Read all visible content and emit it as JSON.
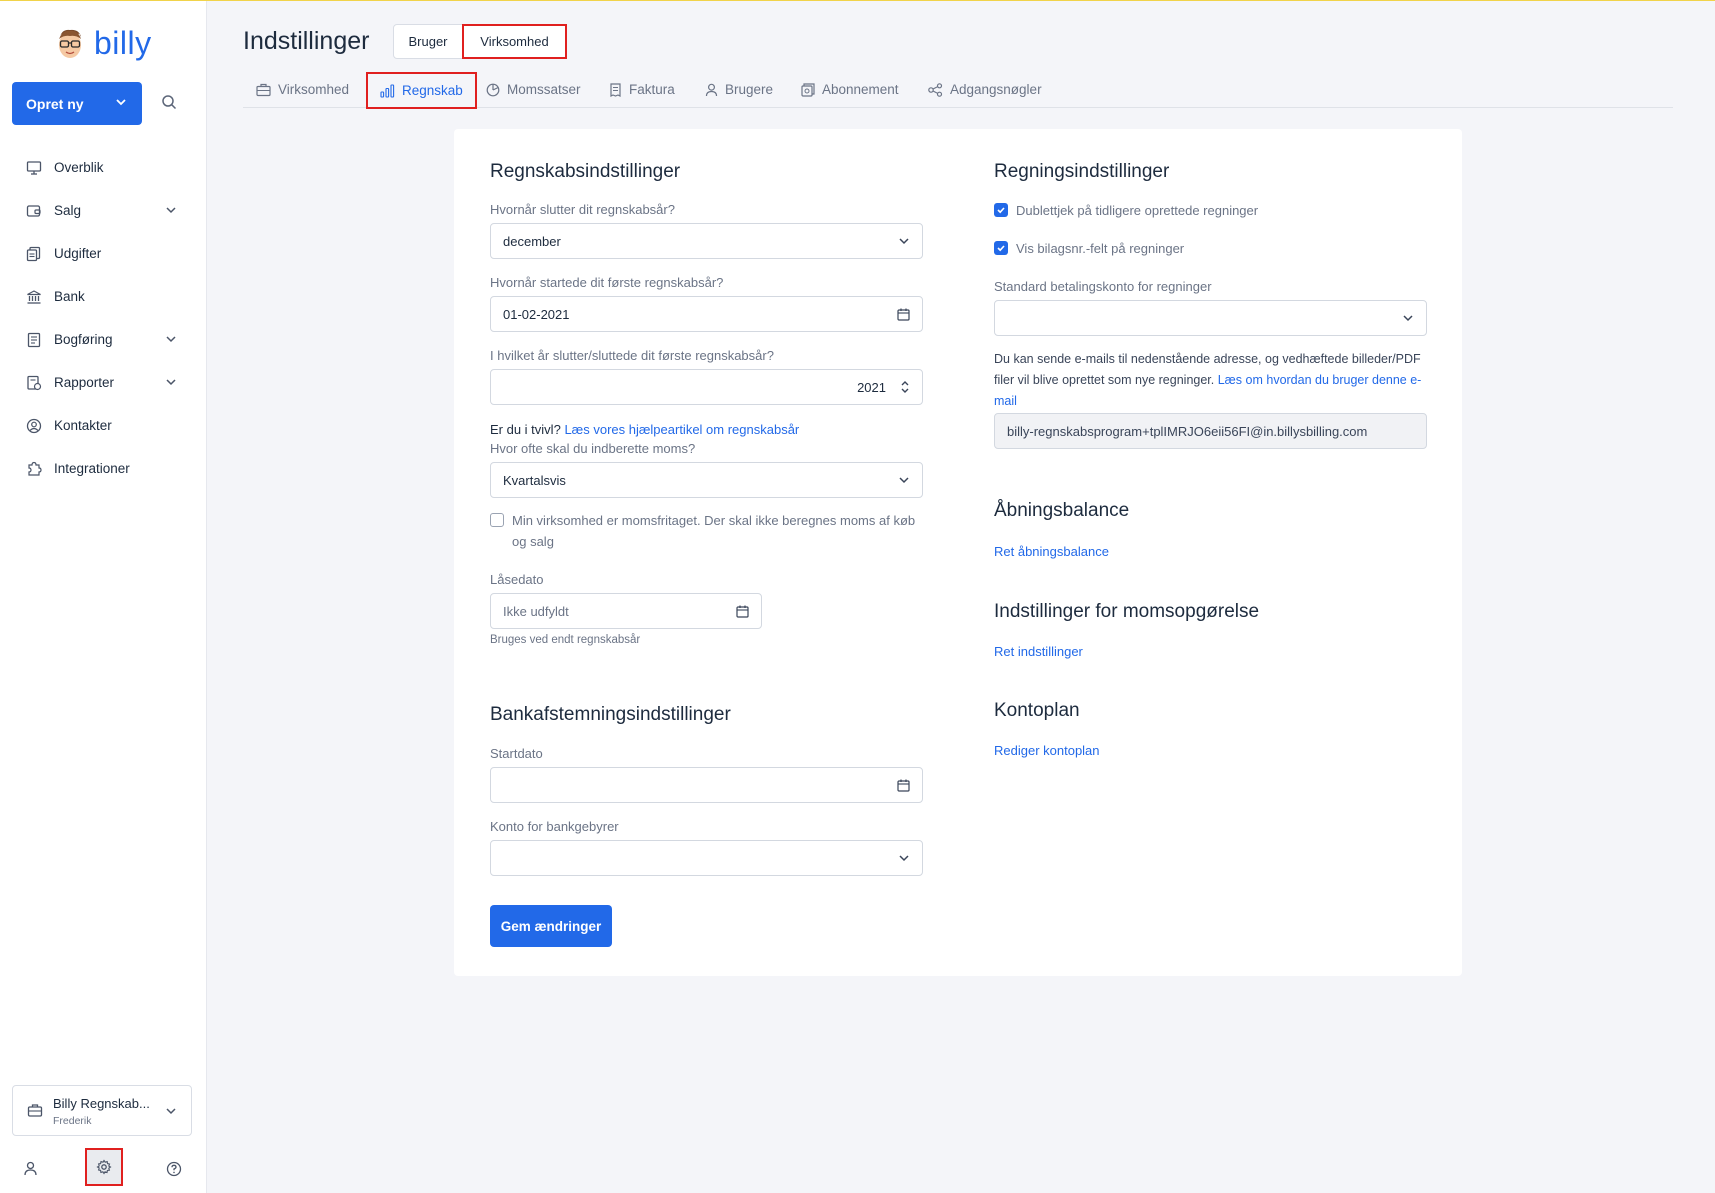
{
  "brand": {
    "name": "billy",
    "accent": "#2269e8"
  },
  "sidebar": {
    "create_label": "Opret ny",
    "items": [
      {
        "label": "Overblik",
        "icon": "monitor-icon",
        "expandable": false
      },
      {
        "label": "Salg",
        "icon": "wallet-icon",
        "expandable": true
      },
      {
        "label": "Udgifter",
        "icon": "receipts-icon",
        "expandable": false
      },
      {
        "label": "Bank",
        "icon": "bank-icon",
        "expandable": false
      },
      {
        "label": "Bogføring",
        "icon": "ledger-icon",
        "expandable": true
      },
      {
        "label": "Rapporter",
        "icon": "report-icon",
        "expandable": true
      },
      {
        "label": "Kontakter",
        "icon": "contact-icon",
        "expandable": false
      },
      {
        "label": "Integrationer",
        "icon": "puzzle-icon",
        "expandable": false
      }
    ],
    "org": {
      "name": "Billy Regnskab...",
      "user": "Frederik"
    }
  },
  "header": {
    "title": "Indstillinger",
    "segments": {
      "user": "Bruger",
      "company": "Virksomhed"
    },
    "tabs": [
      {
        "label": "Virksomhed",
        "icon": "briefcase-icon"
      },
      {
        "label": "Regnskab",
        "icon": "bar-chart-icon"
      },
      {
        "label": "Momssatser",
        "icon": "pie-icon"
      },
      {
        "label": "Faktura",
        "icon": "invoice-icon"
      },
      {
        "label": "Brugere",
        "icon": "user-icon"
      },
      {
        "label": "Abonnement",
        "icon": "subscription-icon"
      },
      {
        "label": "Adgangsnøgler",
        "icon": "key-share-icon"
      }
    ],
    "active_tab": "Regnskab"
  },
  "accounting": {
    "title": "Regnskabsindstillinger",
    "fiscal_end_label": "Hvornår slutter dit regnskabsår?",
    "fiscal_end_value": "december",
    "first_start_label": "Hvornår startede dit første regnskabsår?",
    "first_start_value": "01-02-2021",
    "first_end_label": "I hvilket år slutter/sluttede dit første regnskabsår?",
    "first_end_value": "2021",
    "doubt_text": "Er du i tvivl?",
    "doubt_link": "Læs vores hjælpeartikel om regnskabsår",
    "vat_period_label": "Hvor ofte skal du indberette moms?",
    "vat_period_value": "Kvartalsvis",
    "vat_exempt_label": "Min virksomhed er momsfritaget. Der skal ikke beregnes moms af køb og salg",
    "vat_exempt_checked": false,
    "lock_label": "Låsedato",
    "lock_placeholder": "Ikke udfyldt",
    "lock_hint": "Bruges ved endt regnskabsår"
  },
  "bank": {
    "title": "Bankafstemningsindstillinger",
    "start_label": "Startdato",
    "start_value": "",
    "fee_label": "Konto for bankgebyrer",
    "fee_value": ""
  },
  "save_label": "Gem ændringer",
  "bills": {
    "title": "Regningsindstillinger",
    "dup_check_label": "Dublettjek på tidligere oprettede regninger",
    "dup_check_checked": true,
    "voucher_label": "Vis bilagsnr.-felt på regninger",
    "voucher_checked": true,
    "pay_account_label": "Standard betalingskonto for regninger",
    "pay_account_value": "",
    "email_text_1": "Du kan sende e-mails til nedenstående adresse, og vedhæftede billeder/PDF filer vil blive oprettet som nye regninger.",
    "email_link": "Læs om hvordan du bruger denne e-mail",
    "email_address": "billy-regnskabsprogram+tplIMRJO6eii56FI@in.billysbilling.com"
  },
  "opening": {
    "title": "Åbningsbalance",
    "link": "Ret åbningsbalance"
  },
  "vat_report": {
    "title": "Indstillinger for momsopgørelse",
    "link": "Ret indstillinger"
  },
  "chart_of_accounts": {
    "title": "Kontoplan",
    "link": "Rediger kontoplan"
  }
}
